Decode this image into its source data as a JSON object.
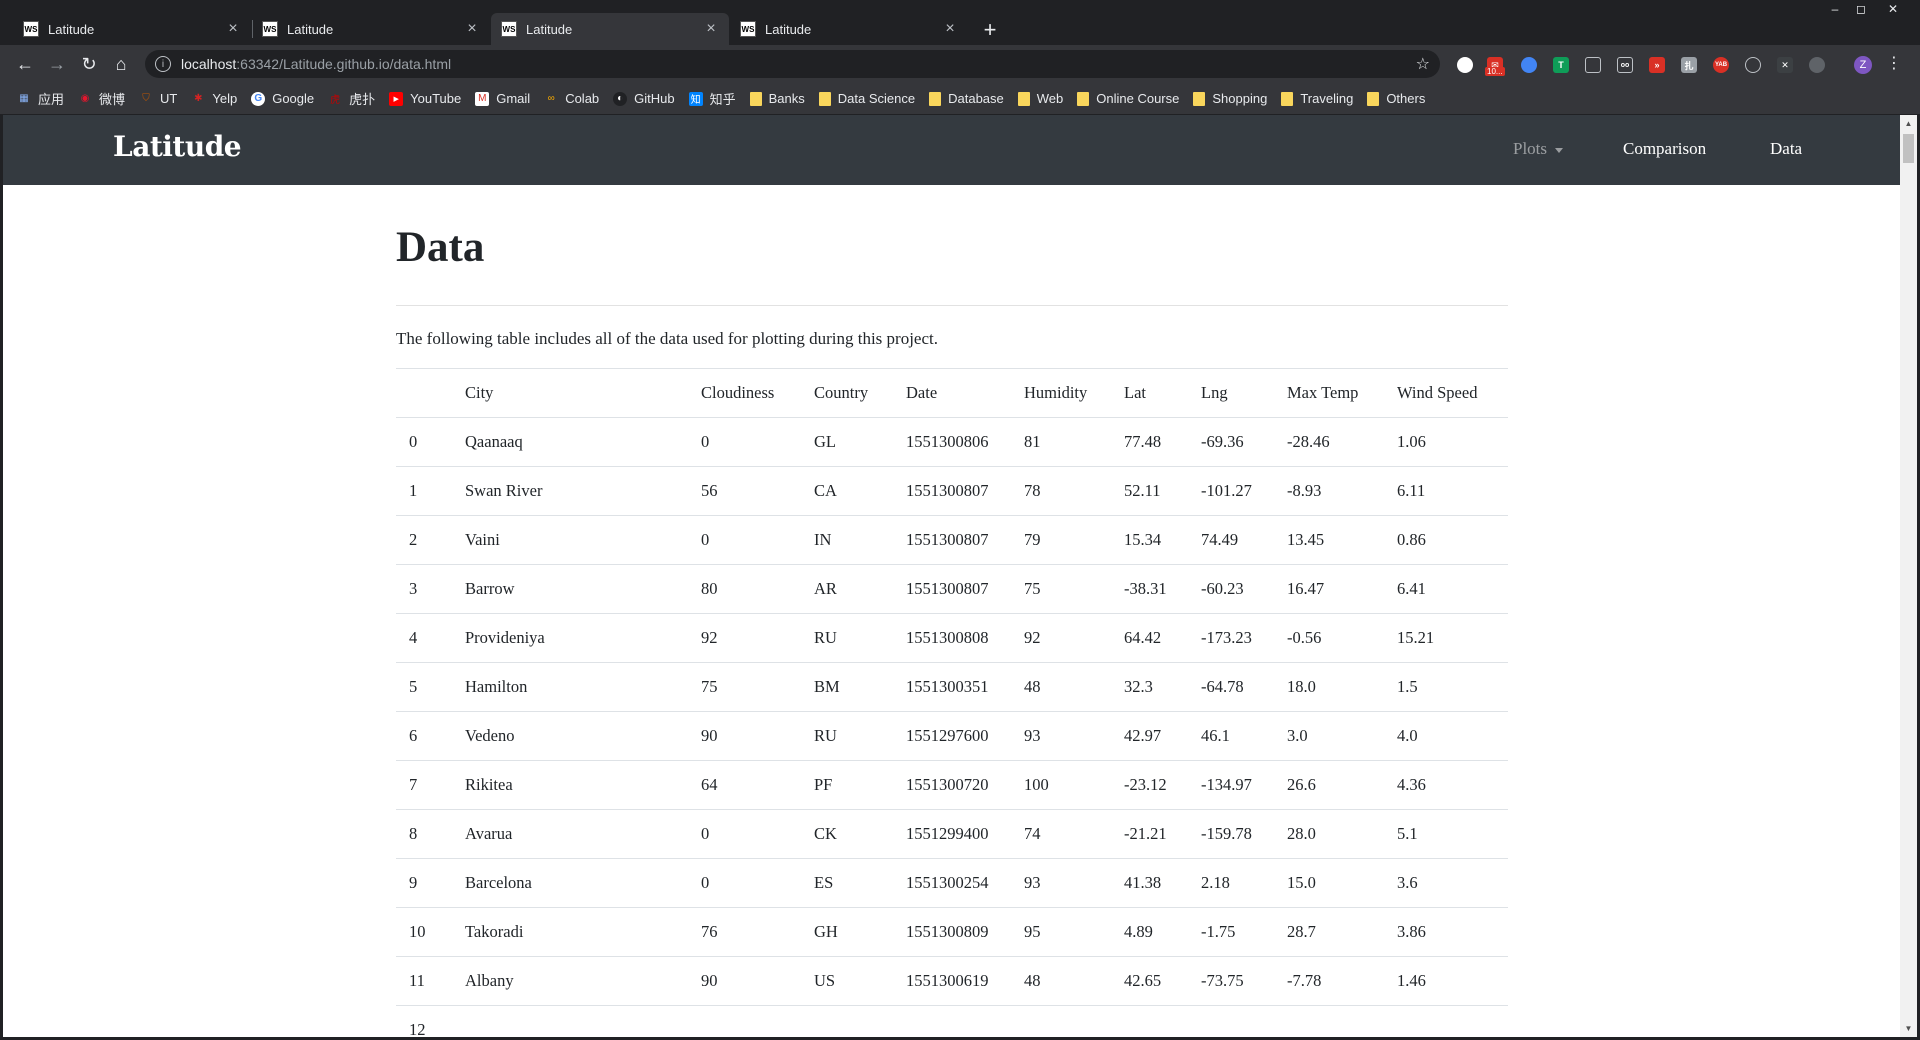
{
  "browser": {
    "tabs": [
      {
        "title": "Latitude",
        "favicon": "WS"
      },
      {
        "title": "Latitude",
        "favicon": "WS"
      },
      {
        "title": "Latitude",
        "favicon": "WS"
      },
      {
        "title": "Latitude",
        "favicon": "WS"
      }
    ],
    "active_tab_index": 2,
    "url_host": "localhost",
    "url_rest": ":63342/Latitude.github.io/data.html",
    "extension_badge": "10...",
    "profile_initial": "Z",
    "bookmarks": [
      {
        "label": "应用",
        "icon": "apps-grid-icon"
      },
      {
        "label": "微博",
        "icon": "weibo-icon"
      },
      {
        "label": "UT",
        "icon": "ut-shield-icon"
      },
      {
        "label": "Yelp",
        "icon": "yelp-icon"
      },
      {
        "label": "Google",
        "icon": "google-icon"
      },
      {
        "label": "虎扑",
        "icon": "hupu-icon"
      },
      {
        "label": "YouTube",
        "icon": "youtube-icon"
      },
      {
        "label": "Gmail",
        "icon": "gmail-icon"
      },
      {
        "label": "Colab",
        "icon": "colab-icon"
      },
      {
        "label": "GitHub",
        "icon": "github-icon"
      },
      {
        "label": "知乎",
        "icon": "zhihu-icon"
      },
      {
        "label": "Banks",
        "icon": "folder-icon"
      },
      {
        "label": "Data Science",
        "icon": "folder-icon"
      },
      {
        "label": "Database",
        "icon": "folder-icon"
      },
      {
        "label": "Web",
        "icon": "folder-icon"
      },
      {
        "label": "Online Course",
        "icon": "folder-icon"
      },
      {
        "label": "Shopping",
        "icon": "folder-icon"
      },
      {
        "label": "Traveling",
        "icon": "folder-icon"
      },
      {
        "label": "Others",
        "icon": "folder-icon"
      }
    ]
  },
  "site": {
    "brand": "Latitude",
    "nav": {
      "plots": "Plots",
      "comparison": "Comparison",
      "data": "Data"
    },
    "title": "Data",
    "intro": "The following table includes all of the data used for plotting during this project."
  },
  "table": {
    "headers": [
      "",
      "City",
      "Cloudiness",
      "Country",
      "Date",
      "Humidity",
      "Lat",
      "Lng",
      "Max Temp",
      "Wind Speed"
    ],
    "rows": [
      [
        "0",
        "Qaanaaq",
        "0",
        "GL",
        "1551300806",
        "81",
        "77.48",
        "-69.36",
        "-28.46",
        "1.06"
      ],
      [
        "1",
        "Swan River",
        "56",
        "CA",
        "1551300807",
        "78",
        "52.11",
        "-101.27",
        "-8.93",
        "6.11"
      ],
      [
        "2",
        "Vaini",
        "0",
        "IN",
        "1551300807",
        "79",
        "15.34",
        "74.49",
        "13.45",
        "0.86"
      ],
      [
        "3",
        "Barrow",
        "80",
        "AR",
        "1551300807",
        "75",
        "-38.31",
        "-60.23",
        "16.47",
        "6.41"
      ],
      [
        "4",
        "Provideniya",
        "92",
        "RU",
        "1551300808",
        "92",
        "64.42",
        "-173.23",
        "-0.56",
        "15.21"
      ],
      [
        "5",
        "Hamilton",
        "75",
        "BM",
        "1551300351",
        "48",
        "32.3",
        "-64.78",
        "18.0",
        "1.5"
      ],
      [
        "6",
        "Vedeno",
        "90",
        "RU",
        "1551297600",
        "93",
        "42.97",
        "46.1",
        "3.0",
        "4.0"
      ],
      [
        "7",
        "Rikitea",
        "64",
        "PF",
        "1551300720",
        "100",
        "-23.12",
        "-134.97",
        "26.6",
        "4.36"
      ],
      [
        "8",
        "Avarua",
        "0",
        "CK",
        "1551299400",
        "74",
        "-21.21",
        "-159.78",
        "28.0",
        "5.1"
      ],
      [
        "9",
        "Barcelona",
        "0",
        "ES",
        "1551300254",
        "93",
        "41.38",
        "2.18",
        "15.0",
        "3.6"
      ],
      [
        "10",
        "Takoradi",
        "76",
        "GH",
        "1551300809",
        "95",
        "4.89",
        "-1.75",
        "28.7",
        "3.86"
      ],
      [
        "11",
        "Albany",
        "90",
        "US",
        "1551300619",
        "48",
        "42.65",
        "-73.75",
        "-7.78",
        "1.46"
      ],
      [
        "12",
        "",
        "",
        "",
        "",
        "",
        "",
        "",
        "",
        ""
      ]
    ]
  },
  "colors": {
    "navbar": "#343a40",
    "chrome": "#35363a",
    "text": "#212529"
  }
}
